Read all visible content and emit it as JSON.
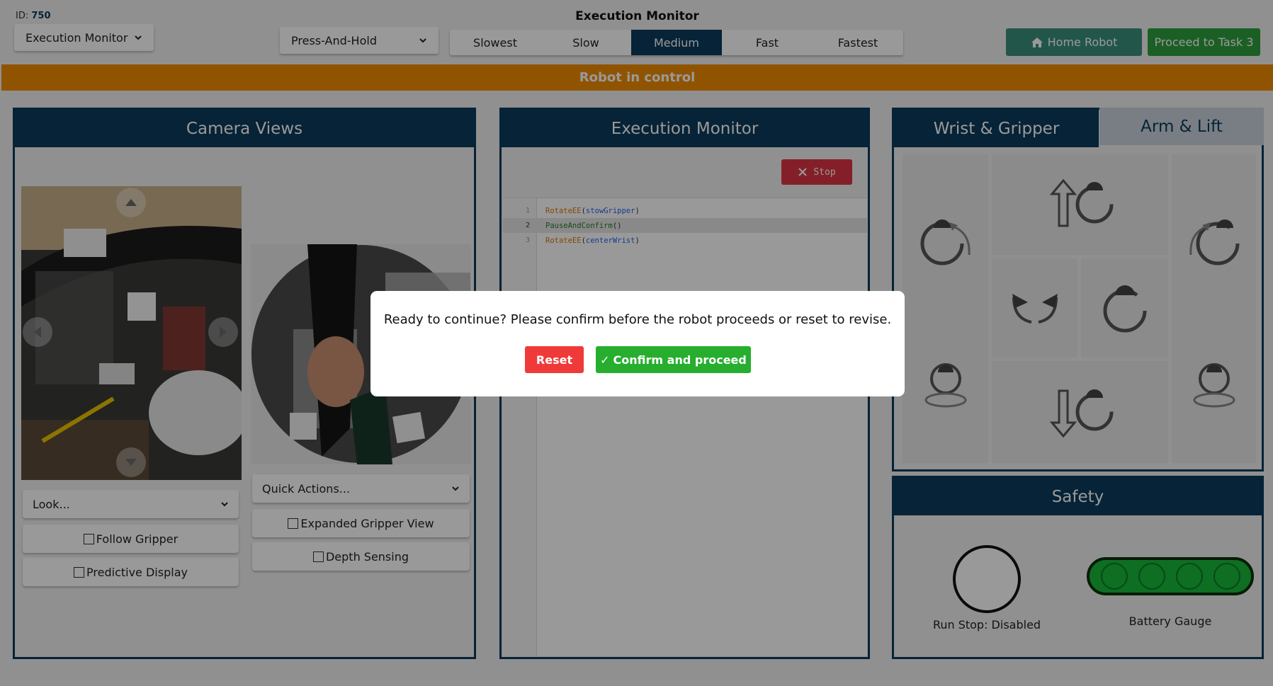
{
  "header": {
    "id_label": "ID:",
    "id_value": "750",
    "title": "Execution Monitor",
    "mode_dropdown": "Execution Monitor",
    "control_dropdown": "Press-And-Hold",
    "speeds": [
      "Slowest",
      "Slow",
      "Medium",
      "Fast",
      "Fastest"
    ],
    "active_speed": "Medium",
    "home_button": "Home Robot",
    "proceed_button": "Proceed to Task 3"
  },
  "banner": {
    "text": "Robot in control",
    "color": "#f08c00"
  },
  "camera_panel": {
    "title": "Camera Views",
    "look_dropdown": "Look...",
    "quick_actions_dropdown": "Quick Actions...",
    "follow_gripper": "Follow Gripper",
    "predictive_display": "Predictive Display",
    "expanded_gripper_view": "Expanded Gripper View",
    "depth_sensing": "Depth Sensing"
  },
  "monitor_panel": {
    "title": "Execution Monitor",
    "stop_button": "Stop",
    "code_lines": [
      {
        "num": "1",
        "fn": "RotateEE",
        "arg": "stowGripper"
      },
      {
        "num": "2",
        "fn": "PauseAndConfirm",
        "arg": ""
      },
      {
        "num": "3",
        "fn": "RotateEE",
        "arg": "centerWrist"
      }
    ],
    "active_line": "2"
  },
  "control_panel": {
    "tab_active": "Wrist & Gripper",
    "tab_inactive": "Arm & Lift"
  },
  "safety_panel": {
    "title": "Safety",
    "runstop_label": "Run Stop: Disabled",
    "battery_label": "Battery Gauge"
  },
  "modal": {
    "message": "Ready to continue? Please confirm before the robot proceeds or reset to revise.",
    "reset_button": "Reset",
    "confirm_button": "Confirm and proceed",
    "confirm_icon": "✓"
  },
  "colors": {
    "navy": "#0b3b5c",
    "home_green": "#3b8f7d",
    "proceed_green": "#2e9e3e",
    "reset_red": "#f03a3a",
    "confirm_green": "#27ae2f",
    "stop_red": "#dc3545"
  }
}
